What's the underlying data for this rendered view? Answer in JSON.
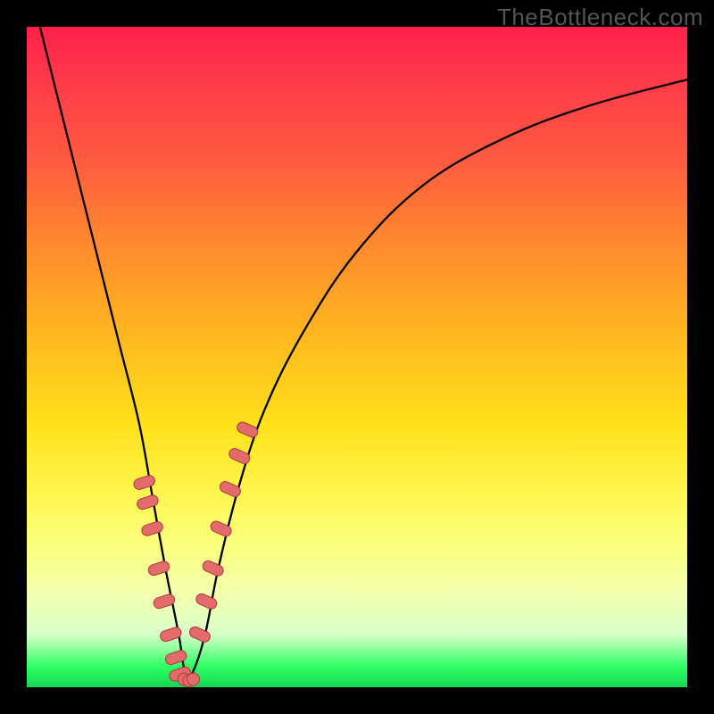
{
  "watermark": "TheBottleneck.com",
  "colors": {
    "frame": "#000000",
    "curve": "#000000",
    "marker_fill": "#e46b6b",
    "marker_stroke": "#a93c3c",
    "gradient_stops": [
      "#ff1f4a",
      "#ff3a4a",
      "#ff5a3f",
      "#ff8a2e",
      "#ffb81f",
      "#ffe019",
      "#fff44a",
      "#fbff7a",
      "#f2ffae",
      "#d8ffc8",
      "#2cff62",
      "#14d653"
    ]
  },
  "chart_data": {
    "type": "line",
    "title": "",
    "xlabel": "",
    "ylabel": "",
    "xlim": [
      0,
      100
    ],
    "ylim": [
      0,
      100
    ],
    "grid": false,
    "note": "Values are read in percent of the plot area; x left→right, y bottom(0)→top(100). The curve dips to ~0 near x≈24% then rises toward the right.",
    "series": [
      {
        "name": "curve",
        "x": [
          2,
          5,
          8,
          11,
          14,
          17,
          19,
          21,
          23,
          24,
          25,
          27,
          29,
          32,
          36,
          42,
          50,
          60,
          72,
          85,
          100
        ],
        "y": [
          100,
          88,
          76,
          64,
          52,
          40,
          29,
          18,
          8,
          2,
          2,
          8,
          18,
          30,
          42,
          54,
          66,
          76,
          83,
          88,
          92
        ]
      },
      {
        "name": "left-branch-markers",
        "x": [
          17.8,
          18.3,
          19.0,
          20.0,
          20.8,
          21.8,
          22.6,
          23.2
        ],
        "y": [
          31.0,
          28.0,
          24.0,
          18.0,
          13.0,
          8.0,
          4.5,
          2.0
        ]
      },
      {
        "name": "right-branch-markers",
        "x": [
          26.2,
          27.2,
          28.2,
          29.4,
          30.8,
          32.2,
          33.4
        ],
        "y": [
          8.0,
          13.0,
          18.0,
          24.0,
          30.0,
          35.0,
          39.0
        ]
      },
      {
        "name": "bottom-markers",
        "x": [
          23.8,
          24.6,
          25.2
        ],
        "y": [
          1.2,
          1.0,
          1.2
        ]
      }
    ]
  }
}
